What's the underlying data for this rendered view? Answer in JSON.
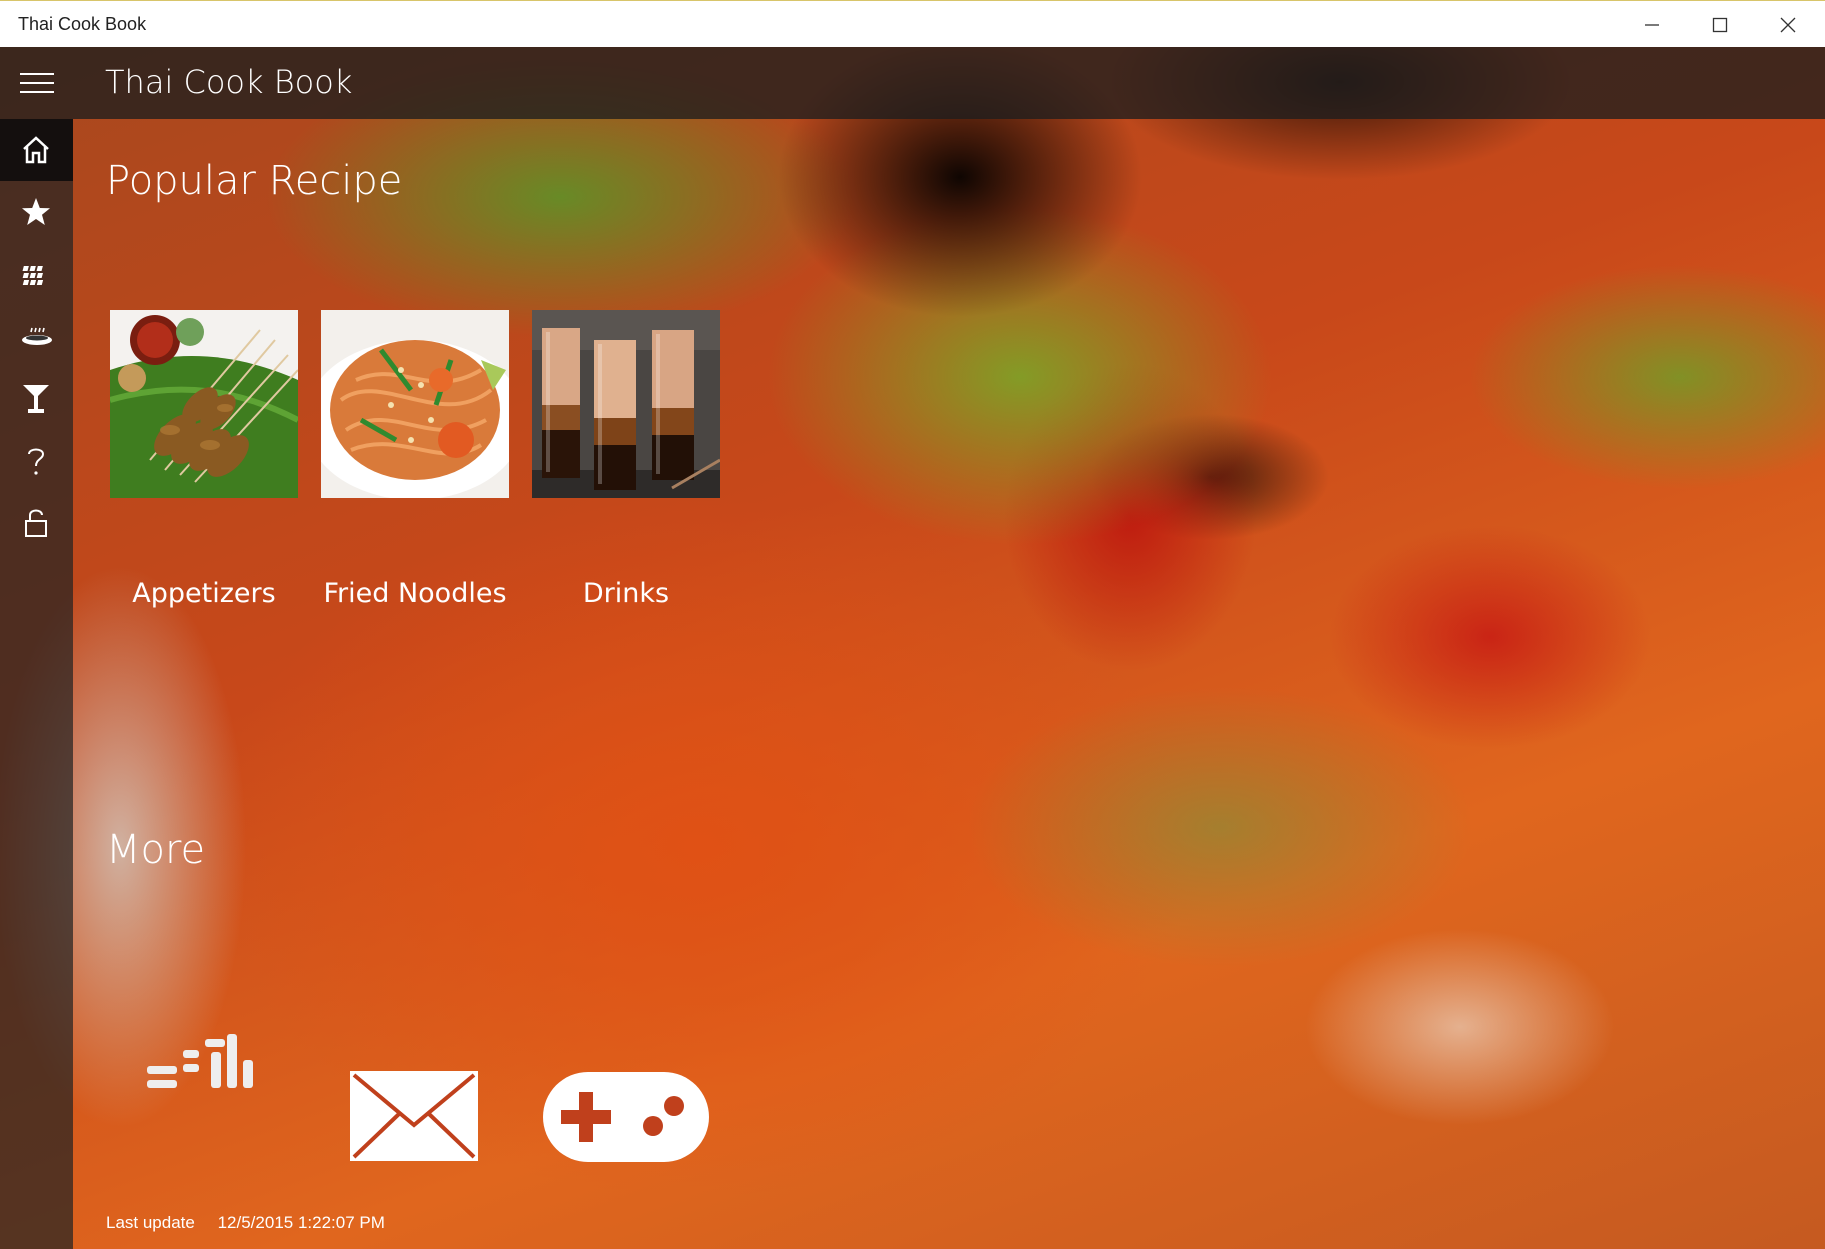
{
  "window": {
    "title": "Thai Cook Book",
    "controls": [
      "minimize-icon",
      "maximize-icon",
      "close-icon"
    ]
  },
  "header": {
    "menu_icon": "hamburger-icon",
    "title": "Thai Cook Book"
  },
  "sidebar": {
    "items": [
      {
        "name": "home",
        "icon": "home-icon",
        "active": true
      },
      {
        "name": "favorites",
        "icon": "star-icon"
      },
      {
        "name": "ingredients",
        "icon": "grill-icon"
      },
      {
        "name": "dishes",
        "icon": "dish-icon"
      },
      {
        "name": "drinks",
        "icon": "cocktail-icon"
      },
      {
        "name": "help",
        "icon": "question-icon"
      },
      {
        "name": "lock",
        "icon": "lock-icon"
      }
    ]
  },
  "popular": {
    "title": "Popular Recipe",
    "items": [
      {
        "label": "Appetizers",
        "image": "satay-skewers"
      },
      {
        "label": "Fried Noodles",
        "image": "pad-thai"
      },
      {
        "label": "Drinks",
        "image": "thai-iced-tea-glasses"
      }
    ]
  },
  "more": {
    "title": "More",
    "items": [
      {
        "name": "stats",
        "icon": "bar-stats-icon"
      },
      {
        "name": "email",
        "icon": "envelope-icon"
      },
      {
        "name": "games",
        "icon": "gamepad-icon"
      }
    ]
  },
  "footer": {
    "last_update_label": "Last update",
    "last_update_value": "12/5/2015 1:22:07 PM"
  },
  "colors": {
    "header_bg": "#1e1e1e",
    "accent_text": "#ffffff",
    "gamepad_cross": "#c0401c"
  }
}
